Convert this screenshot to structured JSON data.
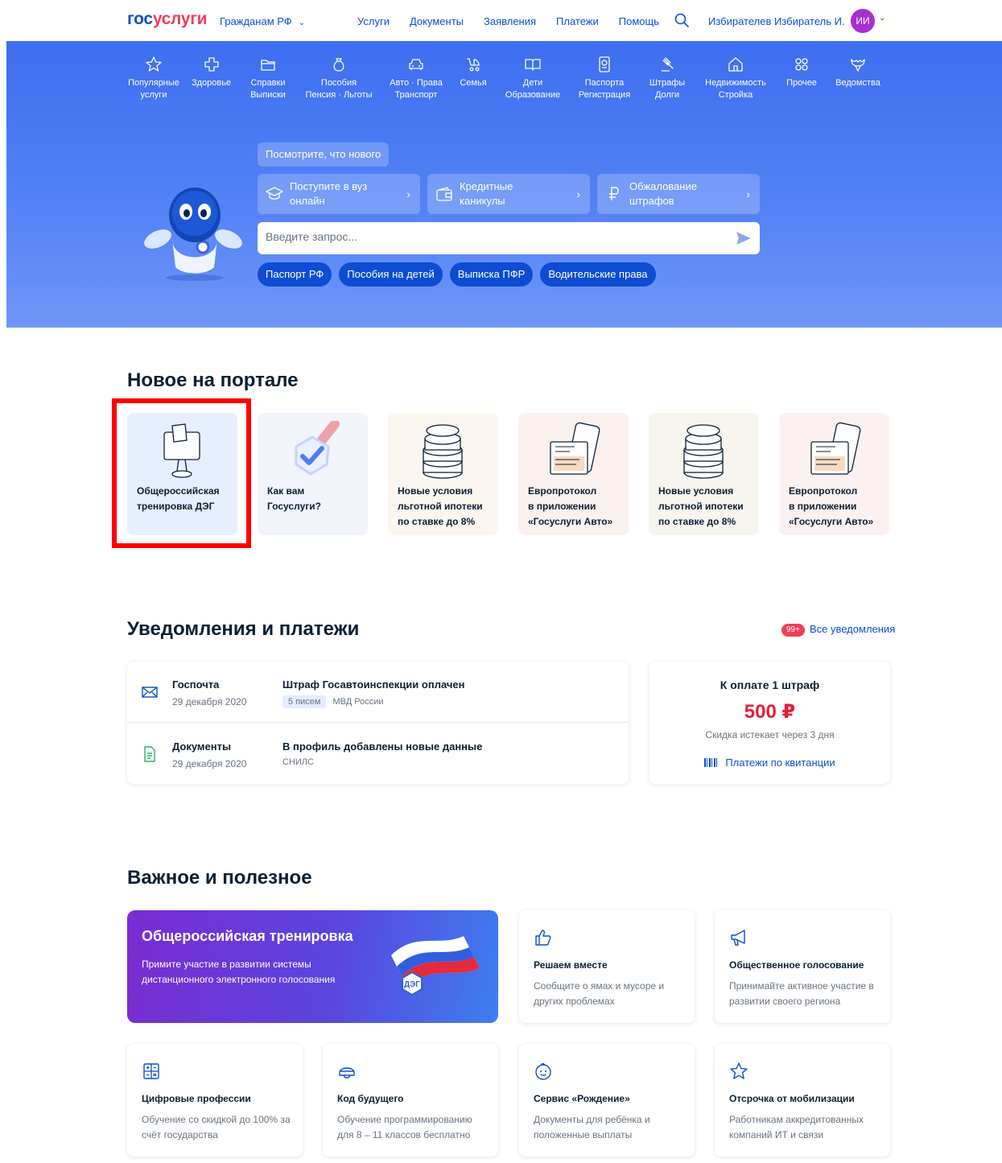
{
  "header": {
    "logo_part1": "гос",
    "logo_part2": "услуги",
    "region": "Гражданам РФ",
    "nav": [
      "Услуги",
      "Документы",
      "Заявления",
      "Платежи",
      "Помощь"
    ],
    "user_name": "Избирателев Избиратель И.",
    "avatar_initials": "ИИ"
  },
  "categories": [
    {
      "label": "Популярные\nуслуги",
      "icon": "star-icon"
    },
    {
      "label": "Здоровье",
      "icon": "medical-cross-icon"
    },
    {
      "label": "Справки\nВыписки",
      "icon": "folder-icon"
    },
    {
      "label": "Пособия\nПенсия · Льготы",
      "icon": "money-bag-icon"
    },
    {
      "label": "Авто · Права\nТранспорт",
      "icon": "car-icon"
    },
    {
      "label": "Семья",
      "icon": "stroller-icon"
    },
    {
      "label": "Дети\nОбразование",
      "icon": "book-icon"
    },
    {
      "label": "Паспорта\nРегистрация",
      "icon": "passport-icon"
    },
    {
      "label": "Штрафы\nДолги",
      "icon": "gavel-icon"
    },
    {
      "label": "Недвижимость\nСтройка",
      "icon": "house-icon"
    },
    {
      "label": "Прочее",
      "icon": "grid-icon"
    },
    {
      "label": "Ведомства",
      "icon": "emblem-icon"
    }
  ],
  "hero": {
    "new_button": "Посмотрите, что нового",
    "promos": [
      {
        "label": "Поступите в вуз\nонлайн",
        "icon": "graduation-cap-icon"
      },
      {
        "label": "Кредитные\nканикулы",
        "icon": "wallet-icon"
      },
      {
        "label": "Обжалование\nштрафов",
        "icon": "ruble-icon"
      }
    ],
    "search_placeholder": "Введите запрос...",
    "chips": [
      "Паспорт РФ",
      "Пособия на детей",
      "Выписка ПФР",
      "Водительские права"
    ]
  },
  "news": {
    "title": "Новое на портале",
    "cards": [
      {
        "title": "Общероссийская\nтренировка ДЭГ",
        "icon": "voting-screen-icon"
      },
      {
        "title": "Как вам\nГосуслуги?",
        "icon": "shield-check-icon"
      },
      {
        "title": "Новые условия\nльготной ипотеки\nпо ставке до 8%",
        "icon": "coins-icon"
      },
      {
        "title": "Европротокол\nв приложении\n«Госуслуги Авто»",
        "icon": "phone-document-icon"
      },
      {
        "title": "Новые условия\nльготной ипотеки\nпо ставке до 8%",
        "icon": "coins-icon"
      },
      {
        "title": "Европротокол\nв приложении\n«Госуслуги Авто»",
        "icon": "phone-document-icon"
      }
    ]
  },
  "notifications": {
    "title": "Уведомления и платежи",
    "badge": "99+",
    "all_link": "Все уведомления",
    "items": [
      {
        "source": "Госпочта",
        "date": "29 декабря 2020",
        "message": "Штраф Госавтоинспекции оплачен",
        "tag": "5 писем",
        "meta": "МВД России",
        "icon": "envelope-icon"
      },
      {
        "source": "Документы",
        "date": "29 декабря 2020",
        "message": "В профиль добавлены новые данные",
        "tag": "",
        "meta": "СНИЛС",
        "icon": "document-icon"
      }
    ],
    "payment": {
      "title": "К оплате 1 штраф",
      "amount": "500 ₽",
      "note": "Скидка истекает через 3 дня",
      "link": "Платежи по квитанции"
    }
  },
  "useful": {
    "title": "Важное и полезное",
    "banner": {
      "title": "Общероссийская тренировка",
      "subtitle": "Примите участие в развитии системы дистанционного электронного голосования",
      "badge": "ДЭГ"
    },
    "cards": [
      {
        "title": "Решаем вместе",
        "desc": "Сообщите о ямах и мусоре и других проблемах",
        "icon": "thumbs-up-icon"
      },
      {
        "title": "Общественное голосование",
        "desc": "Принимайте активное участие в развитии своего региона",
        "icon": "megaphone-icon"
      },
      {
        "title": "Цифровые профессии",
        "desc": "Обучение со скидкой до 100% за счёт государства",
        "icon": "calculator-icon"
      },
      {
        "title": "Код будущего",
        "desc": "Обучение программированию для 8 – 11 классов бесплатно",
        "icon": "helmet-icon"
      },
      {
        "title": "Сервис «Рождение»",
        "desc": "Документы для ребёнка и положенные выплаты",
        "icon": "baby-face-icon"
      },
      {
        "title": "Отсрочка от мобилизации",
        "desc": "Работникам аккредитованных компаний ИТ и связи",
        "icon": "star-outline-icon"
      }
    ]
  },
  "colors": {
    "brand_blue": "#0d4cd3",
    "brand_red": "#ee3f58",
    "amount_red": "#e41d37"
  }
}
